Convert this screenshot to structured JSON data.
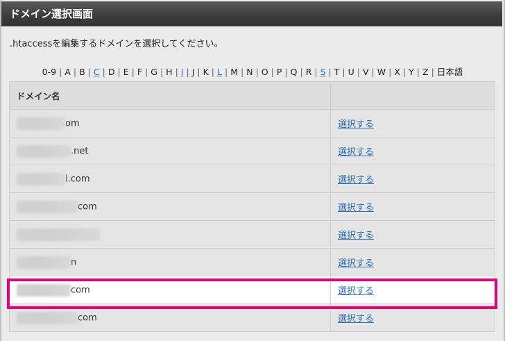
{
  "window": {
    "title": "ドメイン選択画面"
  },
  "description": ".htaccessを編集するドメインを選択してください。",
  "letter_nav": [
    {
      "label": "0-9",
      "link": false
    },
    {
      "label": "A",
      "link": false
    },
    {
      "label": "B",
      "link": false
    },
    {
      "label": "C",
      "link": true
    },
    {
      "label": "D",
      "link": false
    },
    {
      "label": "E",
      "link": false
    },
    {
      "label": "F",
      "link": false
    },
    {
      "label": "G",
      "link": false
    },
    {
      "label": "H",
      "link": false
    },
    {
      "label": "I",
      "link": true
    },
    {
      "label": "J",
      "link": false
    },
    {
      "label": "K",
      "link": false
    },
    {
      "label": "L",
      "link": true
    },
    {
      "label": "M",
      "link": false
    },
    {
      "label": "N",
      "link": false
    },
    {
      "label": "O",
      "link": false
    },
    {
      "label": "P",
      "link": false
    },
    {
      "label": "Q",
      "link": false
    },
    {
      "label": "R",
      "link": false
    },
    {
      "label": "S",
      "link": true
    },
    {
      "label": "T",
      "link": false
    },
    {
      "label": "U",
      "link": false
    },
    {
      "label": "V",
      "link": false
    },
    {
      "label": "W",
      "link": false
    },
    {
      "label": "X",
      "link": false
    },
    {
      "label": "Y",
      "link": false
    },
    {
      "label": "Z",
      "link": false
    },
    {
      "label": "日本語",
      "link": false
    }
  ],
  "table": {
    "header_domain": "ドメイン名",
    "header_action": "",
    "rows": [
      {
        "domain_suffix": "om",
        "action": "選択する",
        "highlighted": false
      },
      {
        "domain_suffix": ".net",
        "action": "選択する",
        "highlighted": false
      },
      {
        "domain_suffix": "l.com",
        "action": "選択する",
        "highlighted": false
      },
      {
        "domain_suffix": "com",
        "action": "選択する",
        "highlighted": false
      },
      {
        "domain_suffix": "",
        "action": "選択する",
        "highlighted": false
      },
      {
        "domain_suffix": "n",
        "action": "選択する",
        "highlighted": false
      },
      {
        "domain_suffix": "com",
        "action": "選択する",
        "highlighted": true
      },
      {
        "domain_suffix": "com",
        "action": "選択する",
        "highlighted": false
      }
    ]
  },
  "colors": {
    "highlight_border": "#e6007e",
    "link": "#2a6db4"
  }
}
